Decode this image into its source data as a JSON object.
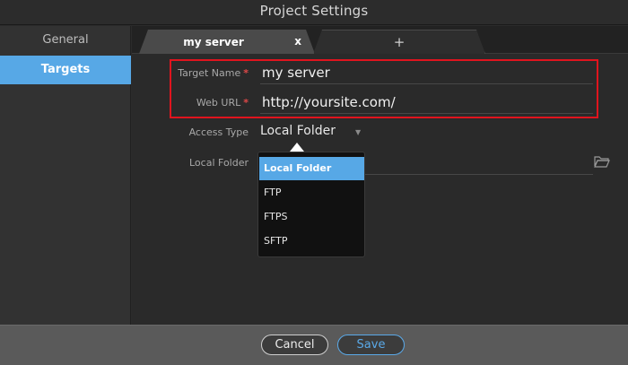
{
  "window": {
    "title": "Project Settings"
  },
  "sidebar": {
    "items": [
      {
        "label": "General",
        "selected": false
      },
      {
        "label": "Targets",
        "selected": true
      }
    ]
  },
  "tabs": {
    "active_label": "my server",
    "close_label": "x",
    "add_label": "+"
  },
  "form": {
    "target_name": {
      "label": "Target Name",
      "required": "*",
      "value": "my server"
    },
    "web_url": {
      "label": "Web URL",
      "required": "*",
      "value": "http://yoursite.com/"
    },
    "access_type": {
      "label": "Access Type",
      "value": "Local Folder",
      "arrow": "▼"
    },
    "local_folder": {
      "label": "Local Folder"
    }
  },
  "dropdown": {
    "options": [
      "Local Folder",
      "FTP",
      "FTPS",
      "SFTP"
    ],
    "selected": "Local Folder"
  },
  "footer": {
    "cancel_label": "Cancel",
    "save_label": "Save"
  },
  "colors": {
    "accent": "#57a8e6",
    "highlight": "#e0141e",
    "required": "#e04848"
  },
  "icons": {
    "folder": "folder-open-icon",
    "dropdown": "chevron-down-icon"
  }
}
